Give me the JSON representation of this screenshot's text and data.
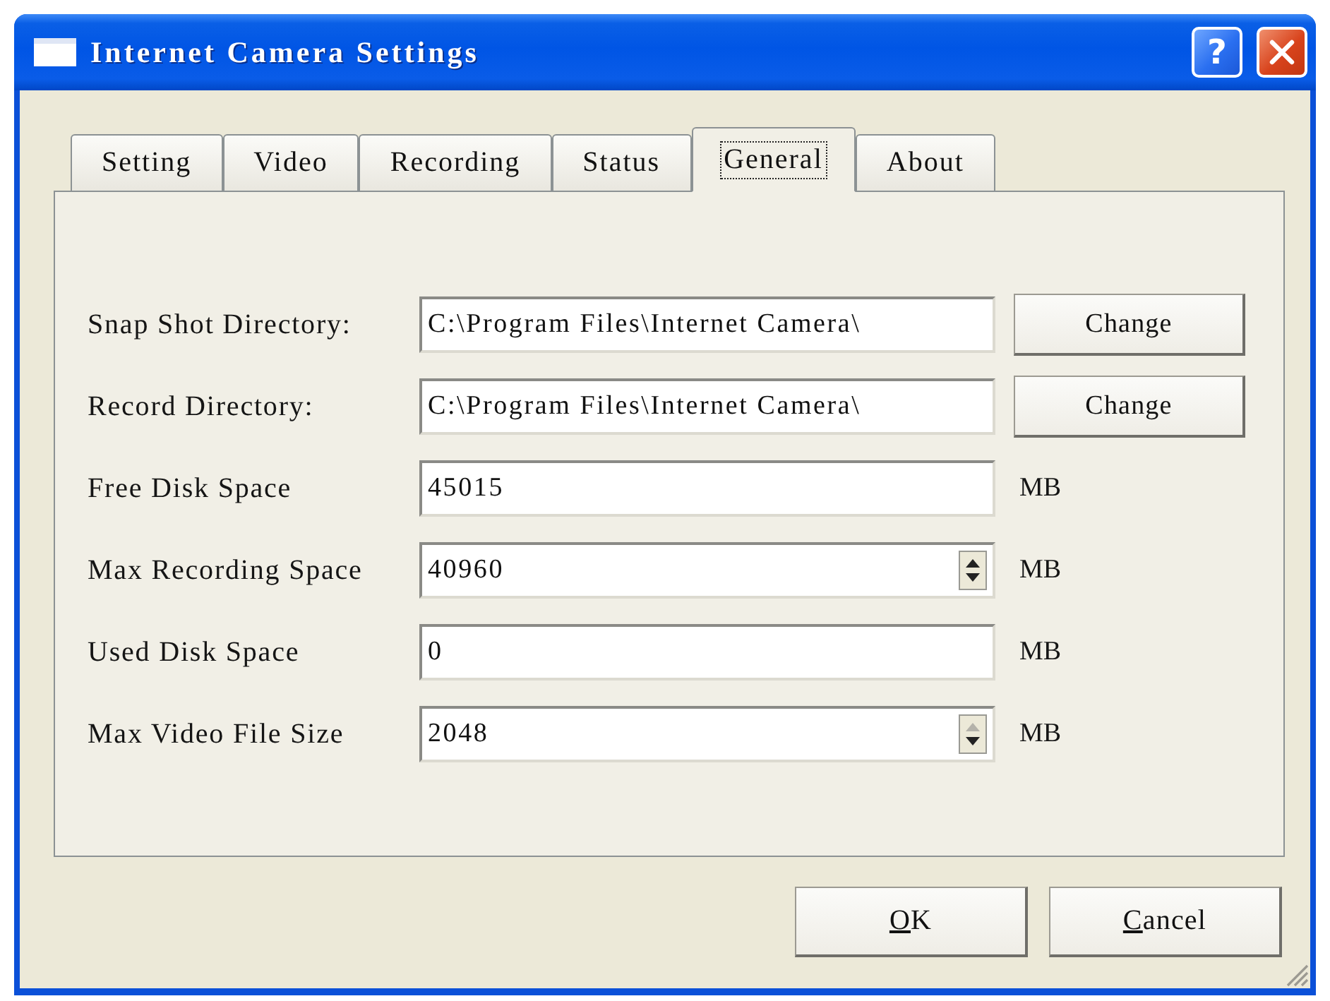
{
  "window": {
    "title": "Internet Camera Settings",
    "help_button": "?"
  },
  "tabs": [
    {
      "label": "Setting",
      "selected": false
    },
    {
      "label": "Video",
      "selected": false
    },
    {
      "label": "Recording",
      "selected": false
    },
    {
      "label": "Status",
      "selected": false
    },
    {
      "label": "General",
      "selected": true
    },
    {
      "label": "About",
      "selected": false
    }
  ],
  "fields": [
    {
      "kind": "directory",
      "label": "Snap Shot Directory:",
      "value": "C:\\Program Files\\Internet Camera\\",
      "button": "Change"
    },
    {
      "kind": "directory",
      "label": "Record Directory:",
      "value": "C:\\Program Files\\Internet Camera\\",
      "button": "Change"
    },
    {
      "kind": "number",
      "label": "Free Disk Space",
      "value": "45015",
      "unit": "MB"
    },
    {
      "kind": "spin",
      "label": "Max Recording Space",
      "value": "40960",
      "unit": "MB",
      "up_disabled": false
    },
    {
      "kind": "number",
      "label": "Used Disk Space",
      "value": "0",
      "unit": "MB"
    },
    {
      "kind": "spin",
      "label": "Max Video File Size",
      "value": "2048",
      "unit": "MB",
      "up_disabled": true
    }
  ],
  "buttons": [
    {
      "label": "OK",
      "mnemonic_underlined": true
    },
    {
      "label": "Cancel",
      "mnemonic_underlined": true
    }
  ]
}
